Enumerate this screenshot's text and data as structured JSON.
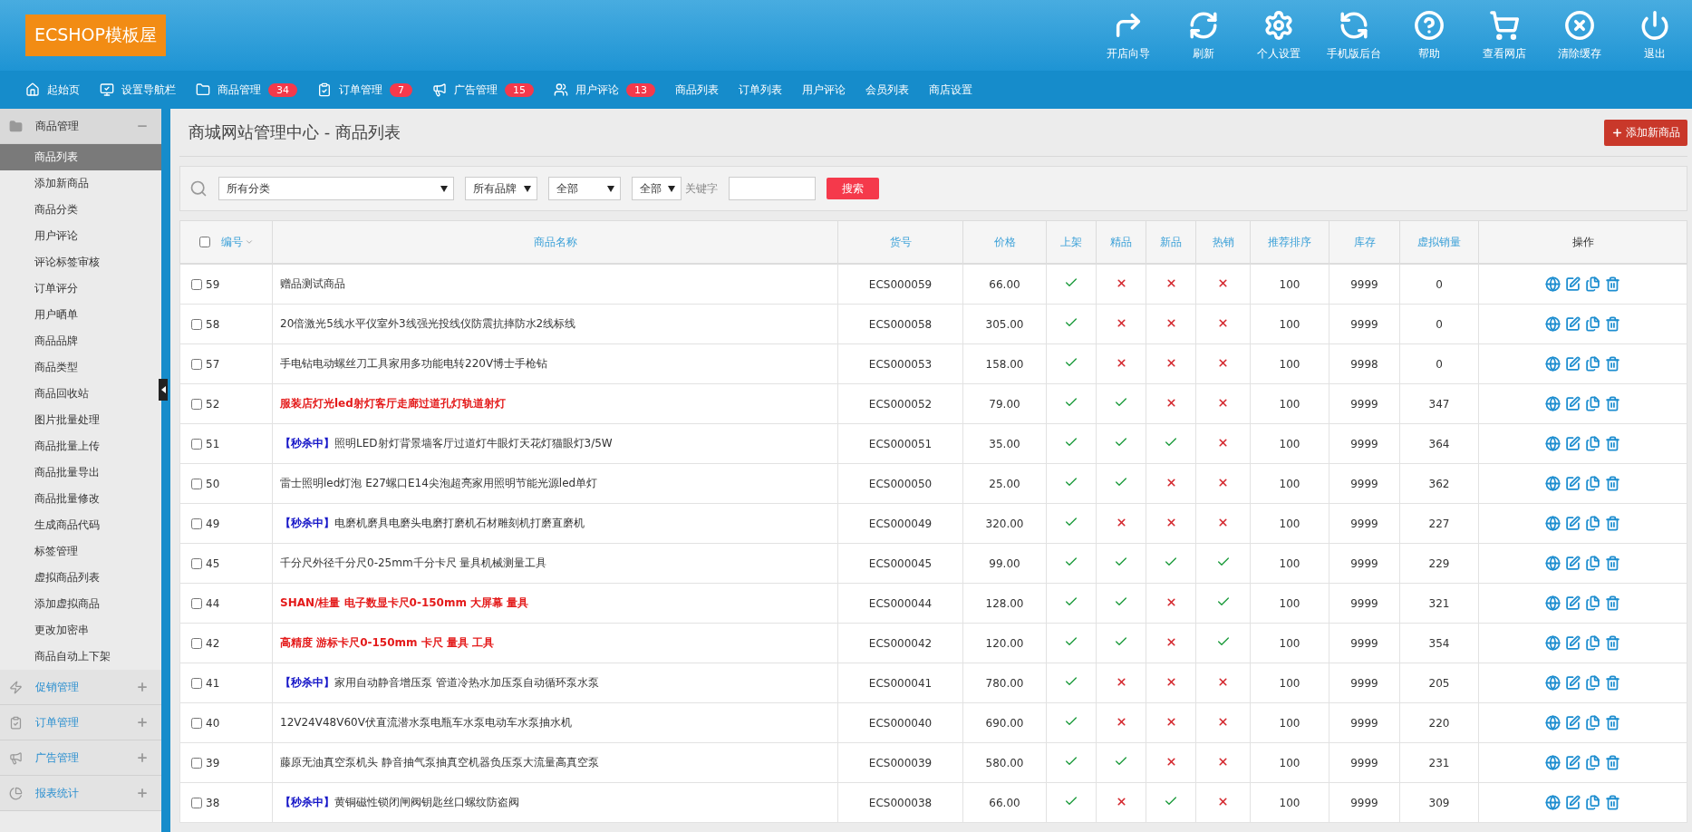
{
  "logo": "ECSHOP模板屋",
  "toolbar": [
    {
      "kind": "wizard",
      "label": "开店向导"
    },
    {
      "kind": "refresh",
      "label": "刷新"
    },
    {
      "kind": "settings",
      "label": "个人设置"
    },
    {
      "kind": "mobile",
      "label": "手机版后台"
    },
    {
      "kind": "help",
      "label": "帮助"
    },
    {
      "kind": "shop",
      "label": "查看网店"
    },
    {
      "kind": "clear",
      "label": "清除缓存"
    },
    {
      "kind": "logout",
      "label": "退出"
    }
  ],
  "nav": [
    {
      "kind": "home",
      "label": "起始页"
    },
    {
      "kind": "nav",
      "label": "设置导航栏"
    },
    {
      "kind": "goods",
      "label": "商品管理",
      "count": "34"
    },
    {
      "kind": "order",
      "label": "订单管理",
      "count": "7"
    },
    {
      "kind": "ad",
      "label": "广告管理",
      "count": "15"
    },
    {
      "kind": "user",
      "label": "用户评论",
      "count": "13"
    },
    {
      "kind": "text",
      "label": "商品列表"
    },
    {
      "kind": "text",
      "label": "订单列表"
    },
    {
      "kind": "text",
      "label": "用户评论"
    },
    {
      "kind": "text",
      "label": "会员列表"
    },
    {
      "kind": "text",
      "label": "商店设置"
    }
  ],
  "sidebar": {
    "groups": [
      {
        "kind": "goods",
        "label": "商品管理",
        "expanded": true,
        "items": [
          {
            "label": "商品列表",
            "selected": true
          },
          {
            "label": "添加新商品",
            "selected": false
          },
          {
            "label": "商品分类",
            "selected": false
          },
          {
            "label": "用户评论",
            "selected": false
          },
          {
            "label": "评论标签审核",
            "selected": false
          },
          {
            "label": "订单评分",
            "selected": false
          },
          {
            "label": "用户晒单",
            "selected": false
          },
          {
            "label": "商品品牌",
            "selected": false
          },
          {
            "label": "商品类型",
            "selected": false
          },
          {
            "label": "商品回收站",
            "selected": false
          },
          {
            "label": "图片批量处理",
            "selected": false
          },
          {
            "label": "商品批量上传",
            "selected": false
          },
          {
            "label": "商品批量导出",
            "selected": false
          },
          {
            "label": "商品批量修改",
            "selected": false
          },
          {
            "label": "生成商品代码",
            "selected": false
          },
          {
            "label": "标签管理",
            "selected": false
          },
          {
            "label": "虚拟商品列表",
            "selected": false
          },
          {
            "label": "添加虚拟商品",
            "selected": false
          },
          {
            "label": "更改加密串",
            "selected": false
          },
          {
            "label": "商品自动上下架",
            "selected": false
          }
        ]
      },
      {
        "kind": "promo",
        "label": "促销管理",
        "expanded": false
      },
      {
        "kind": "order",
        "label": "订单管理",
        "expanded": false
      },
      {
        "kind": "ad",
        "label": "广告管理",
        "expanded": false
      },
      {
        "kind": "report",
        "label": "报表统计",
        "expanded": false
      }
    ]
  },
  "page_title": "商城网站管理中心 - 商品列表",
  "add_button": "添加新商品",
  "filters": {
    "selects": [
      "所有分类",
      "所有品牌",
      "全部",
      "全部"
    ],
    "keyword_label": "关键字",
    "search_button": "搜索"
  },
  "table": {
    "select_all_checked": false,
    "columns": [
      "编号",
      "商品名称",
      "货号",
      "价格",
      "上架",
      "精品",
      "新品",
      "热销",
      "推荐排序",
      "库存",
      "虚拟销量",
      "操作"
    ],
    "rows": [
      {
        "checked": false,
        "id": "59",
        "name": "赠品测试商品",
        "highlight": false,
        "sku": "ECS000059",
        "price": "66.00",
        "on_sale": true,
        "best": false,
        "new": false,
        "hot": false,
        "sort": "100",
        "stock": "9999",
        "virtual_sales": "0"
      },
      {
        "checked": false,
        "id": "58",
        "name": "20倍激光5线水平仪室外3线强光投线仪防震抗摔防水2线标线",
        "highlight": false,
        "sku": "ECS000058",
        "price": "305.00",
        "on_sale": true,
        "best": false,
        "new": false,
        "hot": false,
        "sort": "100",
        "stock": "9999",
        "virtual_sales": "0"
      },
      {
        "checked": false,
        "id": "57",
        "name": "手电钻电动螺丝刀工具家用多功能电转220V博士手枪钻",
        "highlight": false,
        "sku": "ECS000053",
        "price": "158.00",
        "on_sale": true,
        "best": false,
        "new": false,
        "hot": false,
        "sort": "100",
        "stock": "9998",
        "virtual_sales": "0"
      },
      {
        "checked": false,
        "id": "52",
        "name": "服装店灯光led射灯客厅走廊过道孔灯轨道射灯",
        "highlight": true,
        "sku": "ECS000052",
        "price": "79.00",
        "on_sale": true,
        "best": true,
        "new": false,
        "hot": false,
        "sort": "100",
        "stock": "9999",
        "virtual_sales": "347"
      },
      {
        "checked": false,
        "id": "51",
        "tag": "【秒杀中】",
        "name": "照明LED射灯背景墙客厅过道灯牛眼灯天花灯猫眼灯3/5W",
        "highlight": false,
        "sku": "ECS000051",
        "price": "35.00",
        "on_sale": true,
        "best": true,
        "new": true,
        "hot": false,
        "sort": "100",
        "stock": "9999",
        "virtual_sales": "364"
      },
      {
        "checked": false,
        "id": "50",
        "name": "雷士照明led灯泡 E27螺口E14尖泡超亮家用照明节能光源led单灯",
        "highlight": false,
        "sku": "ECS000050",
        "price": "25.00",
        "on_sale": true,
        "best": true,
        "new": false,
        "hot": false,
        "sort": "100",
        "stock": "9999",
        "virtual_sales": "362"
      },
      {
        "checked": false,
        "id": "49",
        "tag": "【秒杀中】",
        "name": "电磨机磨具电磨头电磨打磨机石材雕刻机打磨直磨机",
        "highlight": false,
        "sku": "ECS000049",
        "price": "320.00",
        "on_sale": true,
        "best": false,
        "new": false,
        "hot": false,
        "sort": "100",
        "stock": "9999",
        "virtual_sales": "227"
      },
      {
        "checked": false,
        "id": "45",
        "name": "千分尺外径千分尺0-25mm千分卡尺 量具机械测量工具",
        "highlight": false,
        "sku": "ECS000045",
        "price": "99.00",
        "on_sale": true,
        "best": true,
        "new": true,
        "hot": true,
        "sort": "100",
        "stock": "9999",
        "virtual_sales": "229"
      },
      {
        "checked": false,
        "id": "44",
        "name": "SHAN/桂量 电子数显卡尺0-150mm 大屏幕 量具",
        "highlight": true,
        "sku": "ECS000044",
        "price": "128.00",
        "on_sale": true,
        "best": true,
        "new": false,
        "hot": true,
        "sort": "100",
        "stock": "9999",
        "virtual_sales": "321"
      },
      {
        "checked": false,
        "id": "42",
        "name": "高精度 游标卡尺0-150mm 卡尺 量具 工具",
        "highlight": true,
        "sku": "ECS000042",
        "price": "120.00",
        "on_sale": true,
        "best": true,
        "new": false,
        "hot": true,
        "sort": "100",
        "stock": "9999",
        "virtual_sales": "354"
      },
      {
        "checked": false,
        "id": "41",
        "tag": "【秒杀中】",
        "name": "家用自动静音增压泵 管道冷热水加压泵自动循环泵水泵",
        "highlight": false,
        "sku": "ECS000041",
        "price": "780.00",
        "on_sale": true,
        "best": false,
        "new": false,
        "hot": false,
        "sort": "100",
        "stock": "9999",
        "virtual_sales": "205"
      },
      {
        "checked": false,
        "id": "40",
        "name": "12V24V48V60V伏直流潜水泵电瓶车水泵电动车水泵抽水机",
        "highlight": false,
        "sku": "ECS000040",
        "price": "690.00",
        "on_sale": true,
        "best": false,
        "new": false,
        "hot": false,
        "sort": "100",
        "stock": "9999",
        "virtual_sales": "220"
      },
      {
        "checked": false,
        "id": "39",
        "name": "藤原无油真空泵机头 静音抽气泵抽真空机器负压泵大流量高真空泵",
        "highlight": false,
        "sku": "ECS000039",
        "price": "580.00",
        "on_sale": true,
        "best": true,
        "new": false,
        "hot": false,
        "sort": "100",
        "stock": "9999",
        "virtual_sales": "231"
      },
      {
        "checked": false,
        "id": "38",
        "tag": "【秒杀中】",
        "name": "黄铜磁性锁闭闸阀钥匙丝口螺纹防盗阀",
        "highlight": false,
        "sku": "ECS000038",
        "price": "66.00",
        "on_sale": true,
        "best": false,
        "new": true,
        "hot": false,
        "sort": "100",
        "stock": "9999",
        "virtual_sales": "309"
      }
    ]
  }
}
